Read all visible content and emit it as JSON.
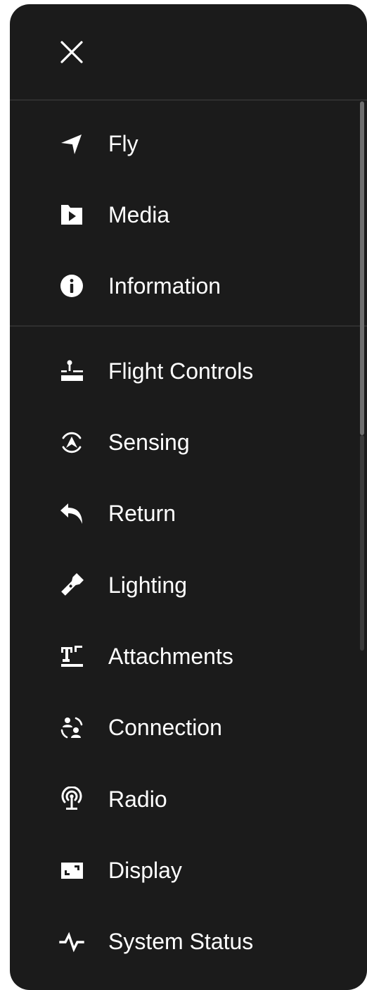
{
  "menu": {
    "close_icon": "close-icon",
    "primary": [
      {
        "id": "fly",
        "label": "Fly",
        "icon": "navigation-arrow-icon"
      },
      {
        "id": "media",
        "label": "Media",
        "icon": "media-folder-play-icon"
      },
      {
        "id": "information",
        "label": "Information",
        "icon": "info-circle-icon"
      }
    ],
    "settings": [
      {
        "id": "flight-controls",
        "label": "Flight Controls",
        "icon": "joystick-icon"
      },
      {
        "id": "sensing",
        "label": "Sensing",
        "icon": "obstacle-sensing-icon"
      },
      {
        "id": "return",
        "label": "Return",
        "icon": "return-arrow-icon"
      },
      {
        "id": "lighting",
        "label": "Lighting",
        "icon": "flashlight-icon"
      },
      {
        "id": "attachments",
        "label": "Attachments",
        "icon": "attachment-mount-icon"
      },
      {
        "id": "connection",
        "label": "Connection",
        "icon": "connection-users-icon"
      },
      {
        "id": "radio",
        "label": "Radio",
        "icon": "radio-antenna-icon"
      },
      {
        "id": "display",
        "label": "Display",
        "icon": "display-screen-icon"
      },
      {
        "id": "system-status",
        "label": "System Status",
        "icon": "pulse-waveform-icon"
      }
    ]
  },
  "colors": {
    "panel_background": "#1b1b1b",
    "divider": "#2f2f2f",
    "text": "#ffffff",
    "scrollbar_thumb": "#6e6e6e"
  }
}
